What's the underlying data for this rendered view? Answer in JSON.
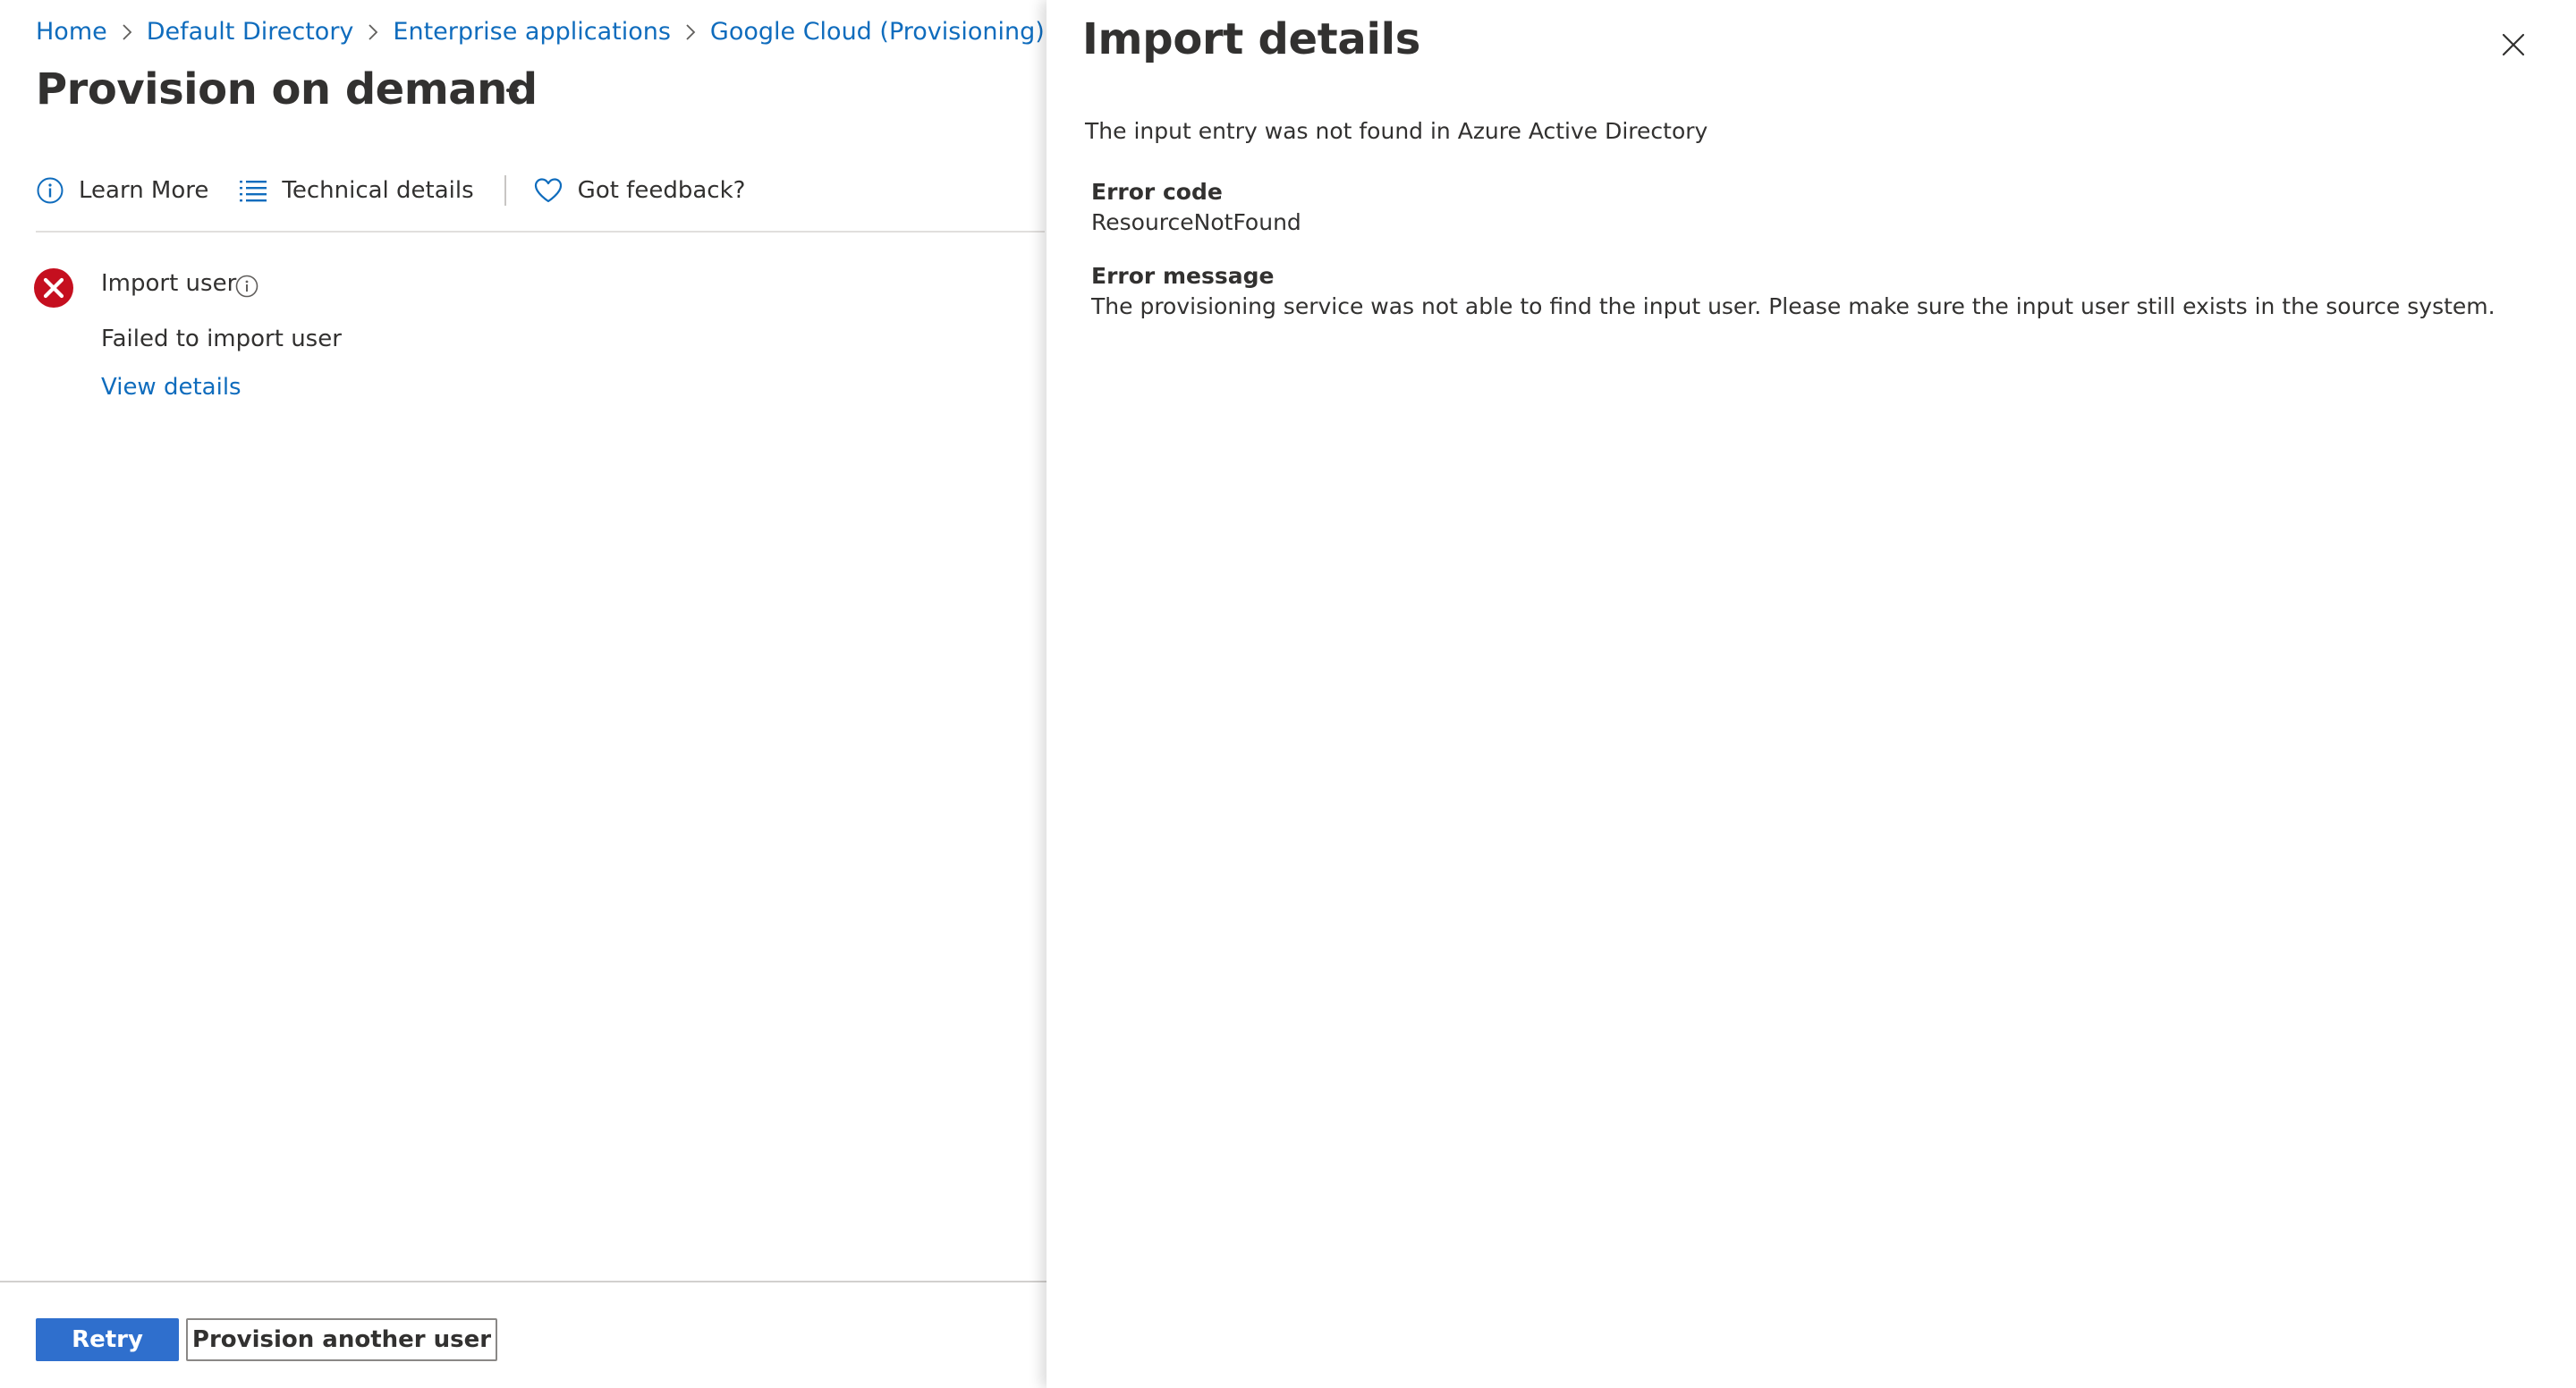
{
  "breadcrumb": [
    {
      "label": "Home"
    },
    {
      "label": "Default Directory"
    },
    {
      "label": "Enterprise applications"
    },
    {
      "label": "Google Cloud (Provisioning)"
    }
  ],
  "page": {
    "title": "Provision on demand",
    "more_label": "···"
  },
  "toolbar": {
    "learn_more": "Learn More",
    "technical_details": "Technical details",
    "feedback": "Got feedback?"
  },
  "step": {
    "title": "Import user",
    "status": "Failed to import user",
    "view_details": "View details",
    "status_icon": "error-circle-icon",
    "status_color": "#c50f1f"
  },
  "footer": {
    "retry_label": "Retry",
    "provision_another_label": "Provision another user"
  },
  "details_pane": {
    "title": "Import details",
    "summary": "The input entry was not found in Azure Active Directory",
    "error_code_label": "Error code",
    "error_code_value": "ResourceNotFound",
    "error_message_label": "Error message",
    "error_message_value": "The provisioning service was not able to find the input user. Please make sure the input user still exists in the source system."
  },
  "colors": {
    "link": "#0f6cbd",
    "primary_button": "#2f6fcd",
    "error": "#c50f1f",
    "text": "#323130"
  }
}
